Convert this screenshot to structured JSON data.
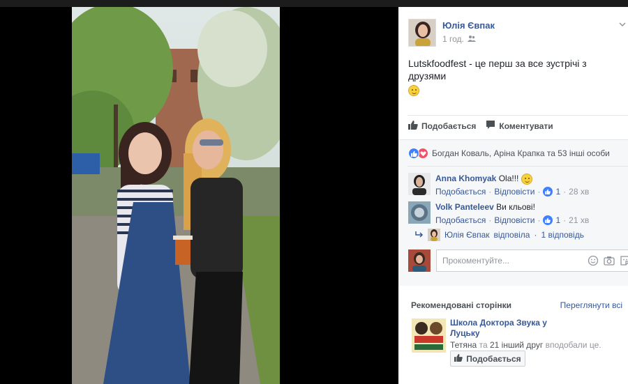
{
  "post": {
    "author": "Юлія Євпак",
    "time": "1 год.",
    "audience_icon": "friends-icon",
    "text": "Lutskfoodfest - це перш за все зустрічі з друзями",
    "text_emoji": "smiley-emoji"
  },
  "actions": {
    "like_label": "Подобається",
    "comment_label": "Коментувати"
  },
  "reactions": {
    "types": [
      "like",
      "love"
    ],
    "summary": "Богдан Коваль, Аріна Крапка та 53 інші особи"
  },
  "comments": [
    {
      "author": "Anna Khomyak",
      "text": "Ola!!!",
      "emoji": "wink-emoji",
      "like_label": "Подобається",
      "reply_label": "Відповісти",
      "likes": "1",
      "time": "28 хв"
    },
    {
      "author": "Volk Panteleev",
      "text": "Ви кльові!",
      "like_label": "Подобається",
      "reply_label": "Відповісти",
      "likes": "1",
      "time": "21 хв"
    }
  ],
  "reply_summary": {
    "author": "Юлія Євпак",
    "action": "відповіла",
    "count_text": "1 відповідь"
  },
  "write_comment": {
    "placeholder": "Прокоментуйте..."
  },
  "recommended": {
    "title": "Рекомендовані сторінки",
    "see_all": "Переглянути всі",
    "page_name": "Школа Доктора Звука у Луцьку",
    "liked_by_name": "Тетяна",
    "liked_by_joiner": "та",
    "liked_by_others": "21 інший друг",
    "liked_by_suffix": "вподобали це.",
    "like_button": "Подобається"
  },
  "colors": {
    "link": "#365899",
    "text": "#1d2129",
    "muted": "#90949c",
    "like_blue": "#4080ff",
    "love_red": "#f25268"
  }
}
